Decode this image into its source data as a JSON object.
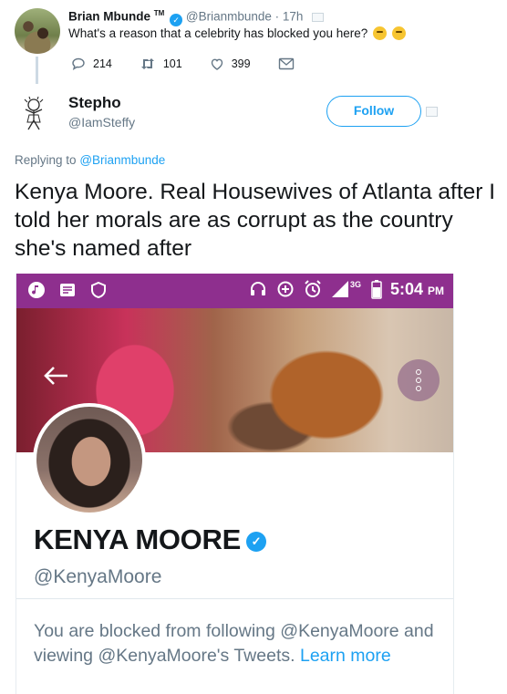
{
  "parent_tweet": {
    "name": "Brian Mbunde",
    "tm": "TM",
    "handle": "@Brianmbunde",
    "separator": "·",
    "time": "17h",
    "text": "What's a reason that a celebrity has blocked you here?",
    "actions": {
      "reply_count": "214",
      "retweet_count": "101",
      "like_count": "399"
    }
  },
  "reply_tweet": {
    "name": "Stepho",
    "handle": "@IamSteffy",
    "follow_label": "Follow",
    "replying_prefix": "Replying to",
    "replying_handle": "@Brianmbunde",
    "text": "Kenya Moore. Real Housewives of Atlanta after I told her morals are as corrupt as the country she's named after"
  },
  "embedded_screenshot": {
    "status_time": "5:04",
    "status_ampm": "PM",
    "network": "3G",
    "status_bar_color": "#8e2f8e",
    "profile": {
      "name": "KENYA MOORE",
      "handle": "@KenyaMoore",
      "blocked_text": "You are blocked from following @KenyaMoore and viewing @KenyaMoore's Tweets.",
      "learn_more": "Learn more"
    }
  },
  "colors": {
    "accent": "#1da1f2",
    "secondary_text": "#657786",
    "primary_text": "#14171a"
  }
}
